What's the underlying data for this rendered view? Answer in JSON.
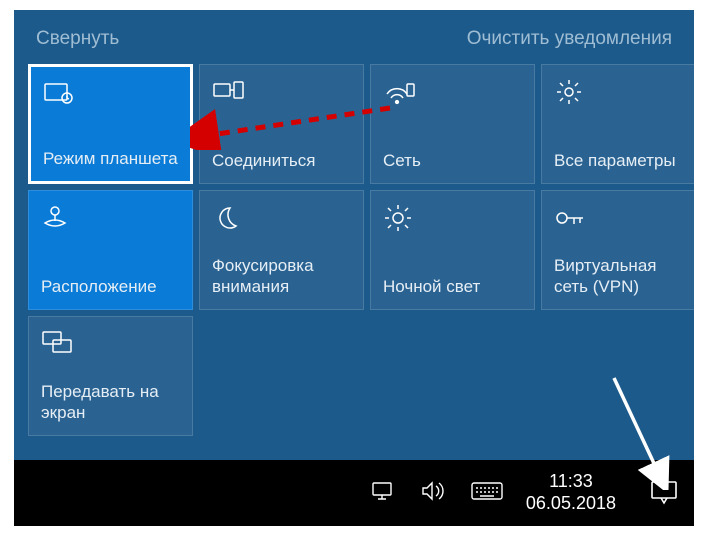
{
  "header": {
    "collapse": "Свернуть",
    "clear": "Очистить уведомления"
  },
  "tiles": [
    {
      "label": "Режим планшета"
    },
    {
      "label": "Соединиться"
    },
    {
      "label": "Сеть"
    },
    {
      "label": "Все параметры"
    },
    {
      "label": "Расположение"
    },
    {
      "label": "Фокусировка внимания"
    },
    {
      "label": "Ночной свет"
    },
    {
      "label": "Виртуальная сеть (VPN)"
    },
    {
      "label": "Передавать на экран"
    }
  ],
  "taskbar": {
    "time": "11:33",
    "date": "06.05.2018"
  }
}
